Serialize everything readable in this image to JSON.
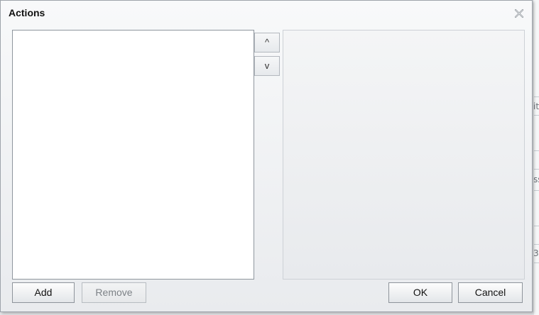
{
  "dialog": {
    "title": "Actions"
  },
  "icons": {
    "close": "close-icon",
    "close_color": "#8a9097"
  },
  "move_buttons": {
    "up_label": "^",
    "down_label": "v"
  },
  "footer": {
    "add_label": "Add",
    "remove_label": "Remove",
    "ok_label": "OK",
    "cancel_label": "Cancel"
  },
  "background_app": {
    "fragments": [
      "it",
      "ss",
      "3"
    ]
  },
  "colors": {
    "dialog_border": "#9ea4ab",
    "list_background": "#ffffff",
    "disabled_text": "#7d8287"
  }
}
